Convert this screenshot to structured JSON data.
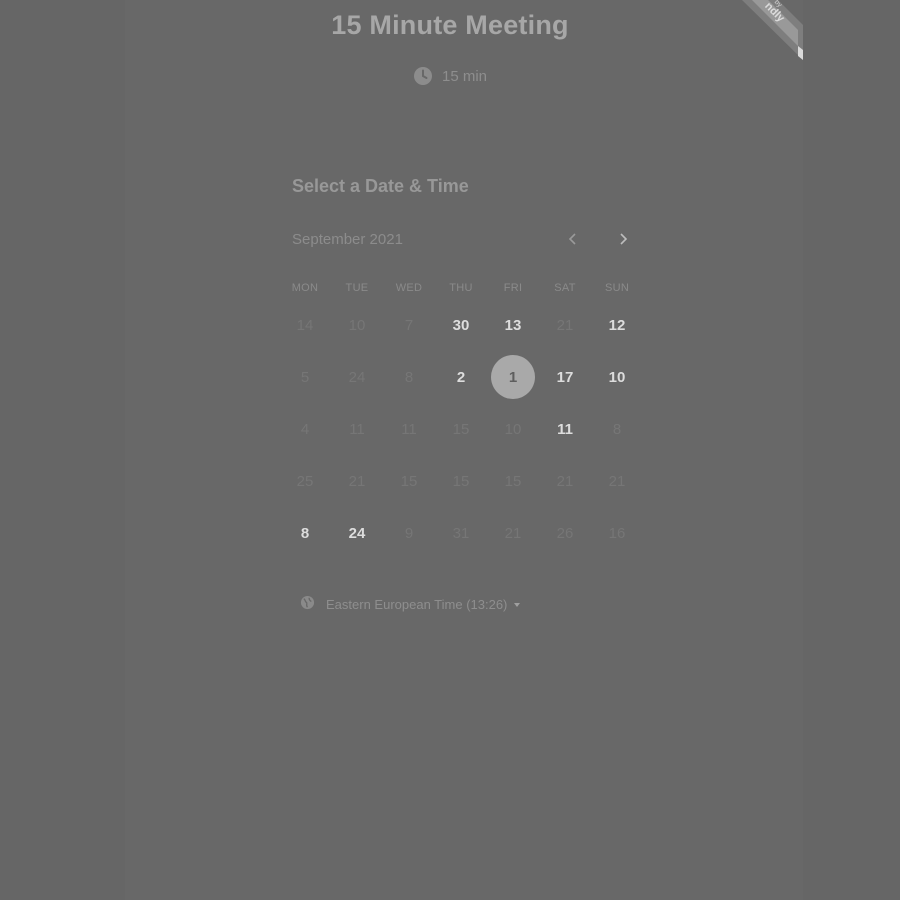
{
  "header": {
    "title": "15 Minute Meeting",
    "duration": "15 min",
    "duration_icon": "clock-icon"
  },
  "badge": {
    "label_top": "by",
    "label_brand": "ndly"
  },
  "calendar": {
    "heading": "Select a Date & Time",
    "month": "September 2021",
    "prev_icon": "chevron-left-icon",
    "next_icon": "chevron-right-icon",
    "weekdays": [
      "MON",
      "TUE",
      "WED",
      "THU",
      "FRI",
      "SAT",
      "SUN"
    ],
    "weeks": [
      [
        {
          "label": "14",
          "available": false
        },
        {
          "label": "10",
          "available": false
        },
        {
          "label": "7",
          "available": false
        },
        {
          "label": "30",
          "available": true
        },
        {
          "label": "13",
          "available": true
        },
        {
          "label": "21",
          "available": false
        },
        {
          "label": "12",
          "available": true
        }
      ],
      [
        {
          "label": "5",
          "available": false
        },
        {
          "label": "24",
          "available": false
        },
        {
          "label": "8",
          "available": false
        },
        {
          "label": "2",
          "available": true
        },
        {
          "label": "1",
          "available": true,
          "selected": true
        },
        {
          "label": "17",
          "available": true
        },
        {
          "label": "10",
          "available": true
        }
      ],
      [
        {
          "label": "4",
          "available": false
        },
        {
          "label": "11",
          "available": false
        },
        {
          "label": "11",
          "available": false
        },
        {
          "label": "15",
          "available": false
        },
        {
          "label": "10",
          "available": false
        },
        {
          "label": "11",
          "available": true
        },
        {
          "label": "8",
          "available": false
        }
      ],
      [
        {
          "label": "25",
          "available": false
        },
        {
          "label": "21",
          "available": false
        },
        {
          "label": "15",
          "available": false
        },
        {
          "label": "15",
          "available": false
        },
        {
          "label": "15",
          "available": false
        },
        {
          "label": "21",
          "available": false
        },
        {
          "label": "21",
          "available": false
        }
      ],
      [
        {
          "label": "8",
          "available": true
        },
        {
          "label": "24",
          "available": true
        },
        {
          "label": "9",
          "available": false
        },
        {
          "label": "31",
          "available": false
        },
        {
          "label": "21",
          "available": false
        },
        {
          "label": "26",
          "available": false
        },
        {
          "label": "16",
          "available": false
        }
      ]
    ]
  },
  "timezone": {
    "label": "Eastern European Time (13:26)",
    "icon": "globe-icon"
  },
  "colors": {
    "background": "#666666",
    "selected_day": "#a9a9a9",
    "available_day": "#dddddd"
  }
}
